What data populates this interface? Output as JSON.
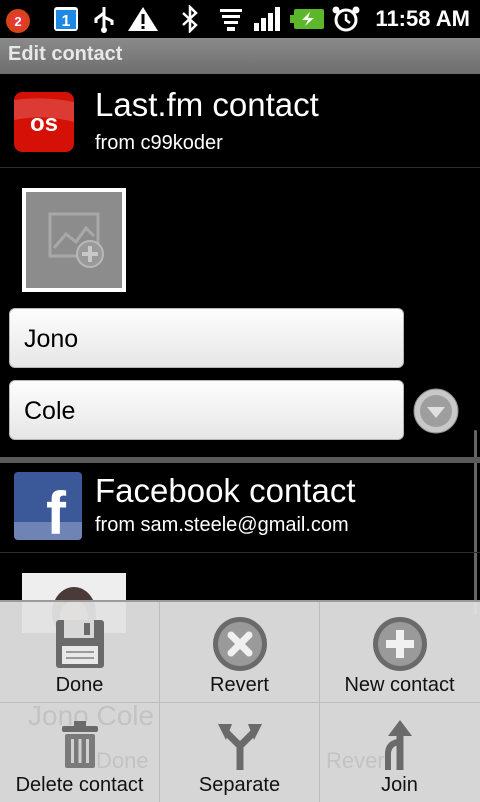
{
  "status_bar": {
    "notification_count": "2",
    "calendar_day": "1",
    "time": "11:58 AM"
  },
  "title": "Edit contact",
  "accounts": [
    {
      "name": "Last.fm contact",
      "from": "from c99koder",
      "logo_text": "os",
      "fields": {
        "first_name": "Jono",
        "last_name": "Cole"
      }
    },
    {
      "name": "Facebook contact",
      "from": "from sam.steele@gmail.com",
      "logo_text": "f"
    }
  ],
  "ghost_text": {
    "name": "Jono Cole",
    "done": "Done",
    "revert": "Revert"
  },
  "menu": {
    "items": [
      {
        "label": "Done",
        "icon": "save-icon"
      },
      {
        "label": "Revert",
        "icon": "revert-icon"
      },
      {
        "label": "New contact",
        "icon": "add-icon"
      },
      {
        "label": "Delete contact",
        "icon": "trash-icon"
      },
      {
        "label": "Separate",
        "icon": "split-icon"
      },
      {
        "label": "Join",
        "icon": "join-icon"
      }
    ]
  },
  "colors": {
    "lastfm_red": "#d51007",
    "facebook_blue": "#3b5998",
    "title_bar": "#7a7a7a",
    "menu_bg": "#e1e1e1"
  }
}
